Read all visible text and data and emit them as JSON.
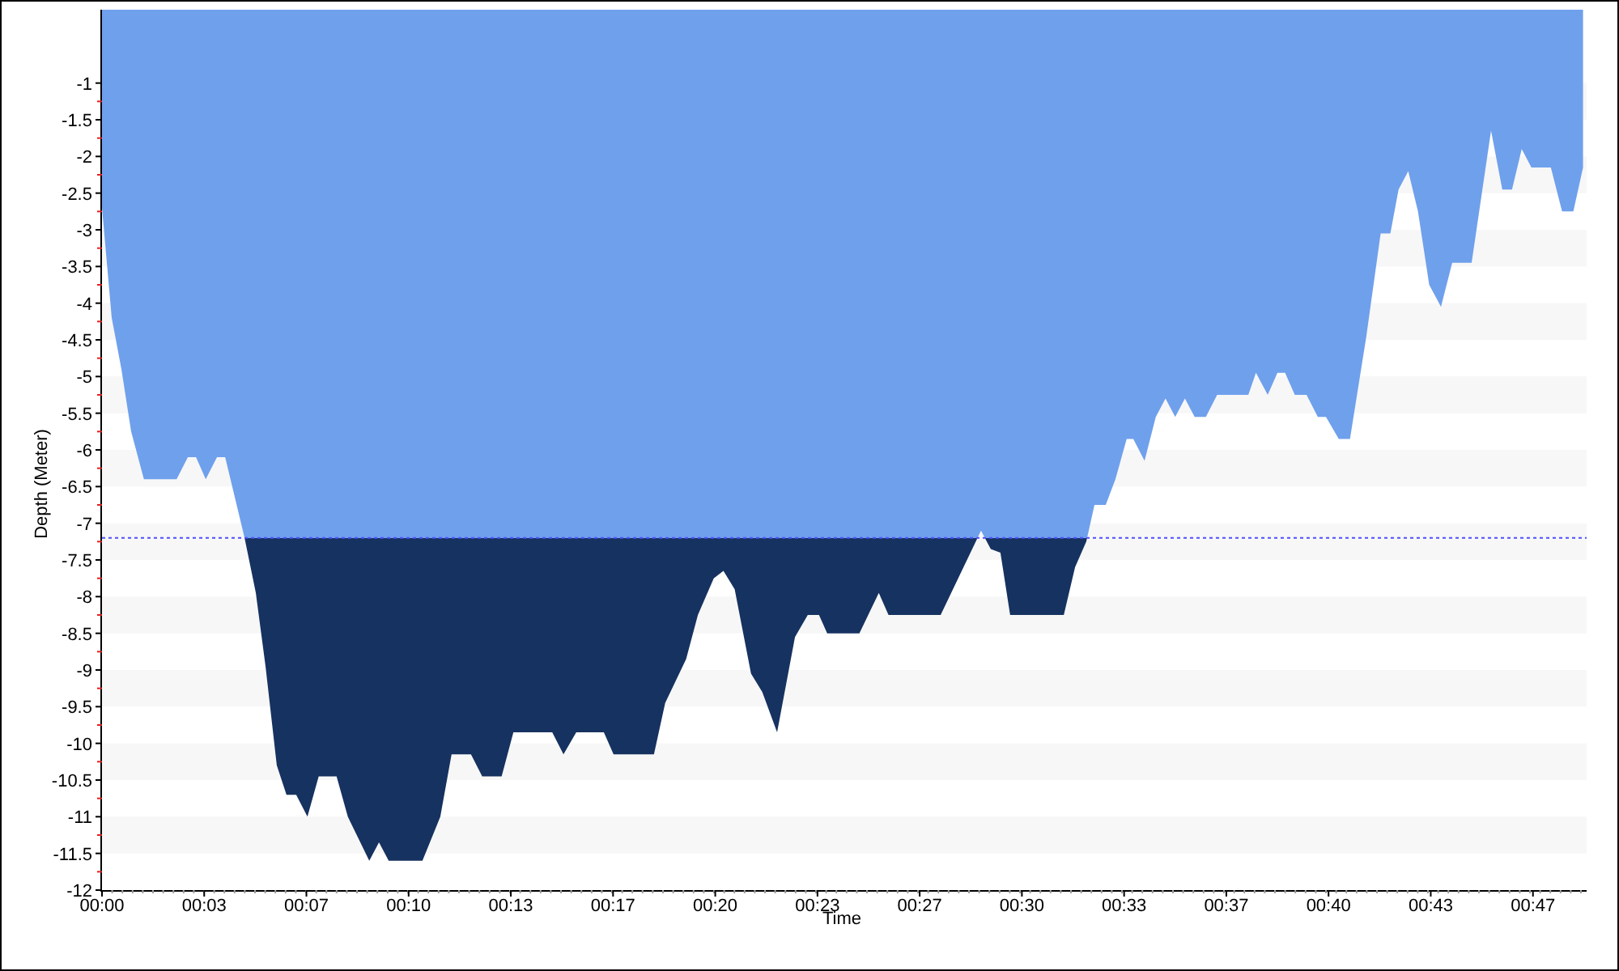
{
  "chart": {
    "chart_data": {
      "type": "area",
      "xlabel": "Time",
      "ylabel": "Depth (Meter)",
      "x": [
        0,
        19,
        38,
        57,
        82,
        146,
        168,
        184,
        203,
        225,
        241,
        279,
        301,
        320,
        342,
        361,
        380,
        402,
        424,
        459,
        481,
        523,
        542,
        561,
        627,
        662,
        684,
        722,
        744,
        782,
        805,
        881,
        903,
        928,
        982,
        1001,
        1080,
        1102,
        1143,
        1166,
        1197,
        1216,
        1238,
        1270,
        1292,
        1321,
        1356,
        1381,
        1403,
        1419,
        1482,
        1520,
        1539,
        1641,
        1720,
        1739,
        1758,
        1777,
        1882,
        1904,
        1926,
        1942,
        1964,
        1983,
        2005,
        2018,
        2040,
        2062,
        2081,
        2100,
        2119,
        2138,
        2160,
        2182,
        2243,
        2258,
        2281,
        2300,
        2315,
        2334,
        2357,
        2379,
        2395,
        2420,
        2442,
        2474,
        2502,
        2521,
        2537,
        2556,
        2575,
        2597,
        2620,
        2642,
        2680,
        2718,
        2740,
        2759,
        2778,
        2797,
        2835,
        2857,
        2879,
        2898
      ],
      "series": [
        {
          "color": "#6fa0ec",
          "values": [
            -2.7,
            -4.2,
            -4.9,
            -5.75,
            -6.4,
            -6.4,
            -6.1,
            -6.1,
            -6.4,
            -6.1,
            -6.1,
            -7.2,
            -7.95,
            -8.95,
            -10.3,
            -10.7,
            -10.7,
            -11.0,
            -10.45,
            -10.45,
            -11.0,
            -11.6,
            -11.35,
            -11.6,
            -11.6,
            -11.0,
            -10.15,
            -10.15,
            -10.45,
            -10.45,
            -9.85,
            -9.85,
            -10.15,
            -9.85,
            -9.85,
            -10.15,
            -10.15,
            -9.45,
            -8.85,
            -8.25,
            -7.75,
            -7.65,
            -7.9,
            -9.05,
            -9.3,
            -9.85,
            -8.55,
            -8.25,
            -8.25,
            -8.5,
            -8.5,
            -7.95,
            -8.25,
            -8.25,
            -7.1,
            -7.35,
            -7.4,
            -8.25,
            -8.25,
            -7.6,
            -7.25,
            -6.75,
            -6.75,
            -6.4,
            -5.85,
            -5.85,
            -6.15,
            -5.55,
            -5.3,
            -5.55,
            -5.3,
            -5.55,
            -5.55,
            -5.25,
            -5.25,
            -4.95,
            -5.25,
            -4.95,
            -4.95,
            -5.25,
            -5.25,
            -5.55,
            -5.55,
            -5.85,
            -5.85,
            -4.45,
            -3.05,
            -3.05,
            -2.45,
            -2.2,
            -2.75,
            -3.75,
            -4.05,
            -3.45,
            -3.45,
            -1.65,
            -2.45,
            -2.45,
            -1.9,
            -2.15,
            -2.15,
            -2.75,
            -2.75,
            -2.15
          ]
        }
      ],
      "xlim": [
        0,
        2905
      ],
      "ylim": [
        -12,
        0
      ],
      "xticks": [
        {
          "value": 0,
          "label": "00:00"
        },
        {
          "value": 200,
          "label": "00:03"
        },
        {
          "value": 400,
          "label": "00:07"
        },
        {
          "value": 600,
          "label": "00:10"
        },
        {
          "value": 800,
          "label": "00:13"
        },
        {
          "value": 1000,
          "label": "00:17"
        },
        {
          "value": 1200,
          "label": "00:20"
        },
        {
          "value": 1400,
          "label": "00:23"
        },
        {
          "value": 1600,
          "label": "00:27"
        },
        {
          "value": 1800,
          "label": "00:30"
        },
        {
          "value": 2000,
          "label": "00:33"
        },
        {
          "value": 2200,
          "label": "00:37"
        },
        {
          "value": 2400,
          "label": "00:40"
        },
        {
          "value": 2600,
          "label": "00:43"
        },
        {
          "value": 2800,
          "label": "00:47"
        }
      ],
      "yticks": [
        -1,
        -1.5,
        -2,
        -2.5,
        -3,
        -3.5,
        -4,
        -4.5,
        -5,
        -5.5,
        -6,
        -6.5,
        -7,
        -7.5,
        -8,
        -8.5,
        -9,
        -9.5,
        -10,
        -10.5,
        -11,
        -11.5,
        -12
      ],
      "ref_lines": [
        {
          "axis": "y",
          "value": -7.2,
          "color": "#4f4fff"
        }
      ]
    }
  }
}
